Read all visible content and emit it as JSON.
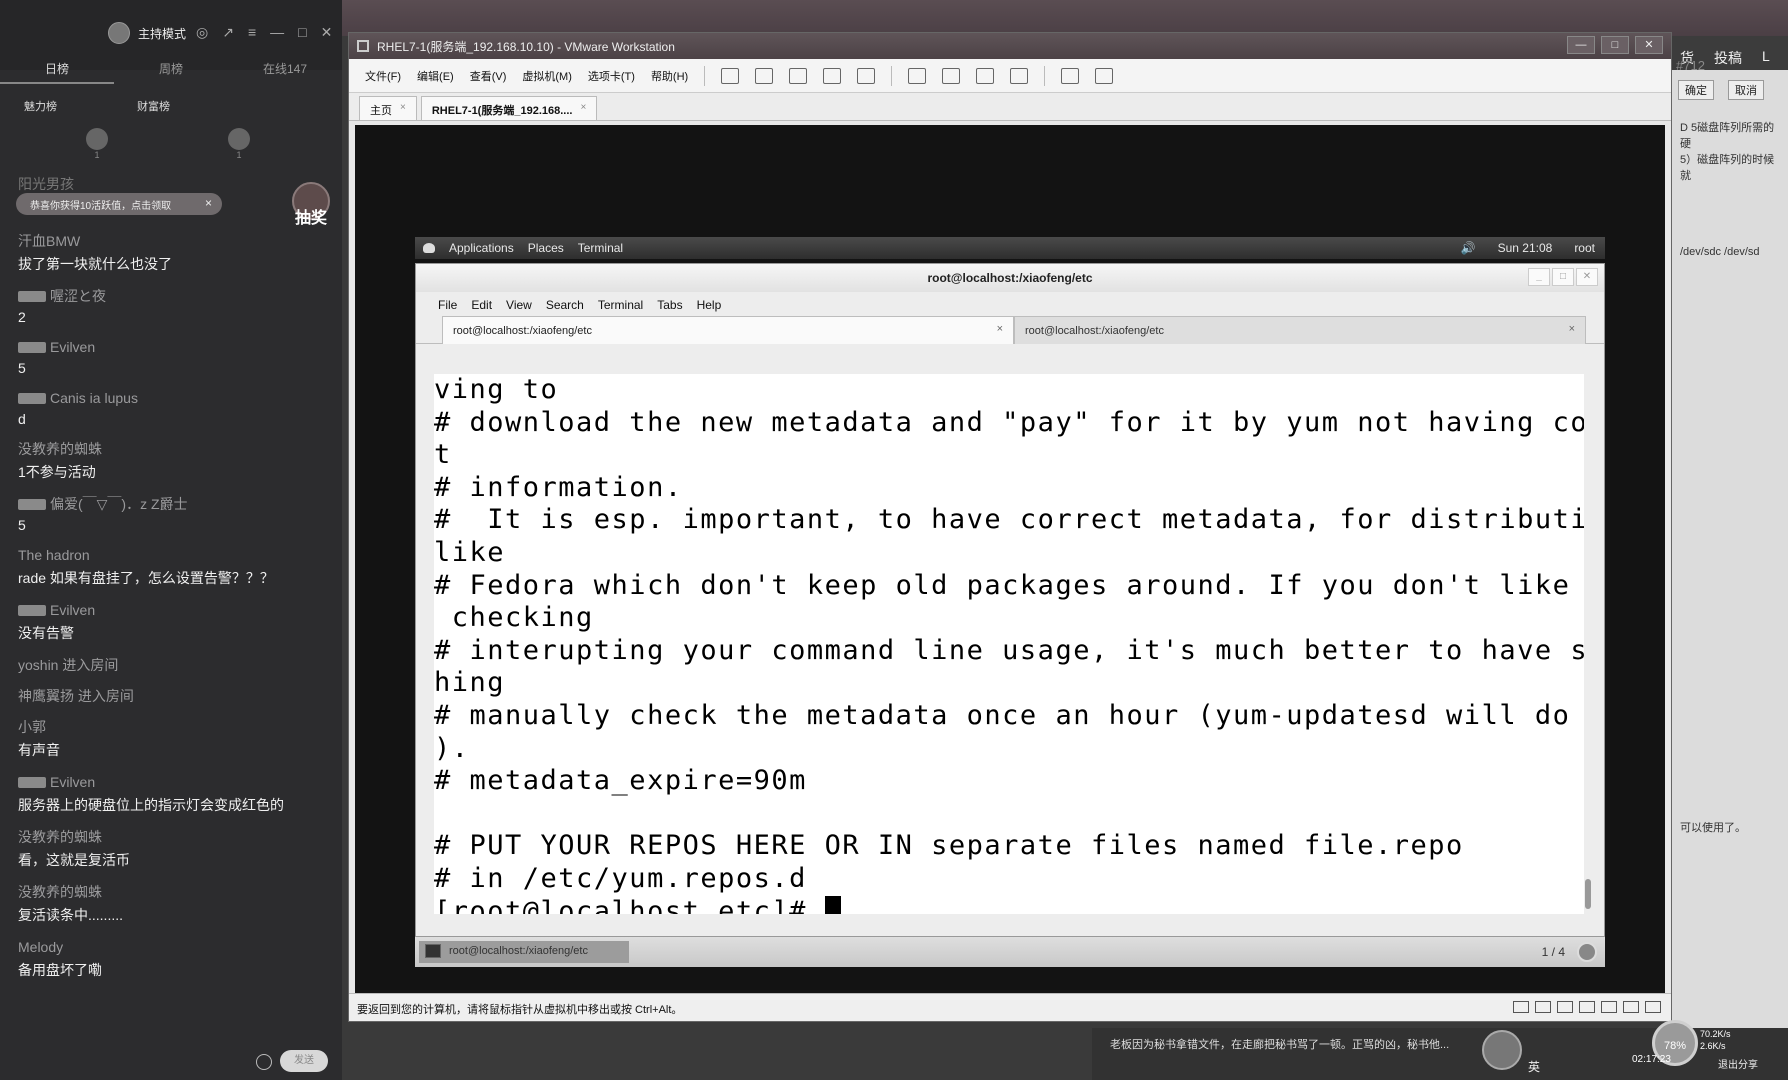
{
  "chat": {
    "host_mode": "主持模式",
    "tabs": [
      "日榜",
      "周榜",
      "在线147"
    ],
    "rank_labels": [
      "魅力榜",
      "财富榜"
    ],
    "rank_counts": [
      "1",
      "1"
    ],
    "partial_name": "阳光男孩",
    "reward_text": "恭喜你获得10活跃值，点击领取",
    "reward_close": "×",
    "lottery": "抽奖",
    "messages": [
      {
        "name": "汗血BMW",
        "text": "拔了第一块就什么也没了",
        "badge": false
      },
      {
        "name": "喔涩と夜",
        "text": "2",
        "badge": true
      },
      {
        "name": "Evilven",
        "text": "5",
        "badge": true
      },
      {
        "name": "Canis ia lupus",
        "text": "d",
        "badge": true
      },
      {
        "name": "没教养的蜘蛛",
        "text": "1不参与活动",
        "badge": false
      },
      {
        "name": "偏爱(￣▽￣)．z Z爵士",
        "text": "5",
        "badge": true
      },
      {
        "name": "The hadron",
        "text": "rade 如果有盘挂了，怎么设置告警？？？",
        "badge": false
      },
      {
        "name": "Evilven",
        "text": "没有告警",
        "badge": true
      },
      {
        "name": "yoshin 进入房间",
        "text": "",
        "badge": false
      },
      {
        "name": "神鹰翼扬 进入房间",
        "text": "",
        "badge": false
      },
      {
        "name": "小郭",
        "text": "有声音",
        "badge": false
      },
      {
        "name": "Evilven",
        "text": "服务器上的硬盘位上的指示灯会变成红色的",
        "badge": true
      },
      {
        "name": "没教养的蜘蛛",
        "text": "看，这就是复活币",
        "badge": false
      },
      {
        "name": "没教养的蜘蛛",
        "text": "复活读条中.........",
        "badge": false
      },
      {
        "name": "Melody",
        "text": "备用盘坏了嘞",
        "badge": false
      }
    ],
    "send_label": "发送"
  },
  "right_panel": {
    "nav": [
      "货",
      "投稿",
      "L"
    ],
    "buttons": [
      "确定",
      "取消"
    ],
    "lines": [
      "D 5磁盘阵列所需的硬",
      "5）磁盘阵列的时候就",
      "/dev/sdc /dev/sd",
      "可以使用了。"
    ],
    "counter": "#712"
  },
  "vmware": {
    "title": "RHEL7-1(服务端_192.168.10.10) - VMware Workstation",
    "window_buttons": [
      "—",
      "□",
      "✕"
    ],
    "menu": [
      "文件(F)",
      "编辑(E)",
      "查看(V)",
      "虚拟机(M)",
      "选项卡(T)",
      "帮助(H)"
    ],
    "tabs": [
      {
        "label": "主页",
        "close": "×"
      },
      {
        "label": "RHEL7-1(服务端_192.168....",
        "close": "×"
      }
    ],
    "status_text": "要返回到您的计算机，请将鼠标指针从虚拟机中移出或按 Ctrl+Alt。"
  },
  "gnome": {
    "applications": "Applications",
    "places": "Places",
    "terminal": "Terminal",
    "clock": "Sun 21:08",
    "user": "root",
    "volume_icon": "speaker-icon"
  },
  "terminal": {
    "title": "root@localhost:/xiaofeng/etc",
    "menu": [
      "File",
      "Edit",
      "View",
      "Search",
      "Terminal",
      "Tabs",
      "Help"
    ],
    "tabs": [
      {
        "label": "root@localhost:/xiaofeng/etc",
        "close": "×"
      },
      {
        "label": "root@localhost:/xiaofeng/etc",
        "close": "×"
      }
    ],
    "lines": [
      "ving to",
      "# download the new metadata and \"pay\" for it by yum not having correc",
      "t",
      "# information.",
      "#  It is esp. important, to have correct metadata, for distributions",
      "like",
      "# Fedora which don't keep old packages around. If you don't like this",
      " checking",
      "# interupting your command line usage, it's much better to have somet",
      "hing",
      "# manually check the metadata once an hour (yum-updatesd will do this",
      ").",
      "# metadata_expire=90m",
      "",
      "# PUT YOUR REPOS HERE OR IN separate files named file.repo",
      "# in /etc/yum.repos.d",
      "[root@localhost etc]# "
    ],
    "taskbar_item": "root@localhost:/xiaofeng/etc",
    "pages": "1 / 4"
  },
  "taskbar": {
    "notice": "老板因为秘书拿错文件，在走廊把秘书骂了一顿。正骂的凶，秘书他...",
    "ime": "英",
    "battery": "78%",
    "net_up": "70.2K/s",
    "net_down": "2.6K/s",
    "clock": "02:17:23",
    "share": "退出分享"
  }
}
